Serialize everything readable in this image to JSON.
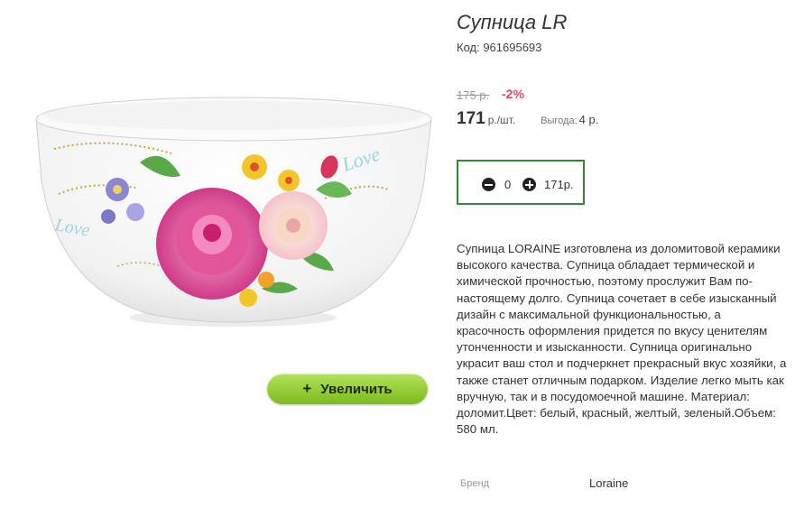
{
  "product": {
    "title": "Супница LR",
    "code": "Код: 961695693"
  },
  "pricing": {
    "old_price": "175 р.",
    "discount": "-2%",
    "price": "171",
    "unit": "р./шт.",
    "savings_label": "Выгода:",
    "savings_value": "4 р."
  },
  "quantity": {
    "value": "0",
    "total": "171р."
  },
  "image": {
    "zoom_button_label": "Увеличить",
    "zoom_button_icon": "+",
    "bowl_decor_text_left": "Love",
    "bowl_decor_text_right": "Love"
  },
  "description": "Супница LORAINE изготовлена из доломитовой керамики высокого качества. Супница обладает термической и химической прочностью, поэтому прослужит Вам по-настоящему долго. Супница сочетает в себе изысканный дизайн с максимальной функциональностью, а красочность оформления придется по вкусу ценителям утонченности и изысканности. Супница оригинально украсит ваш стол и подчеркнет прекрасный вкус хозяйки, а также станет отличным подарком. Изделие легко мыть как вручную, так и в посудомоечной машине. Материал: доломит.Цвет: белый, красный, желтый, зеленый.Объем: 580 мл.",
  "brand": {
    "label": "Бренд",
    "value": "Loraine"
  },
  "colors": {
    "zoom_button": "#8ccb2a",
    "quantity_border": "#2f8a2f",
    "discount": "#d84b6e"
  }
}
